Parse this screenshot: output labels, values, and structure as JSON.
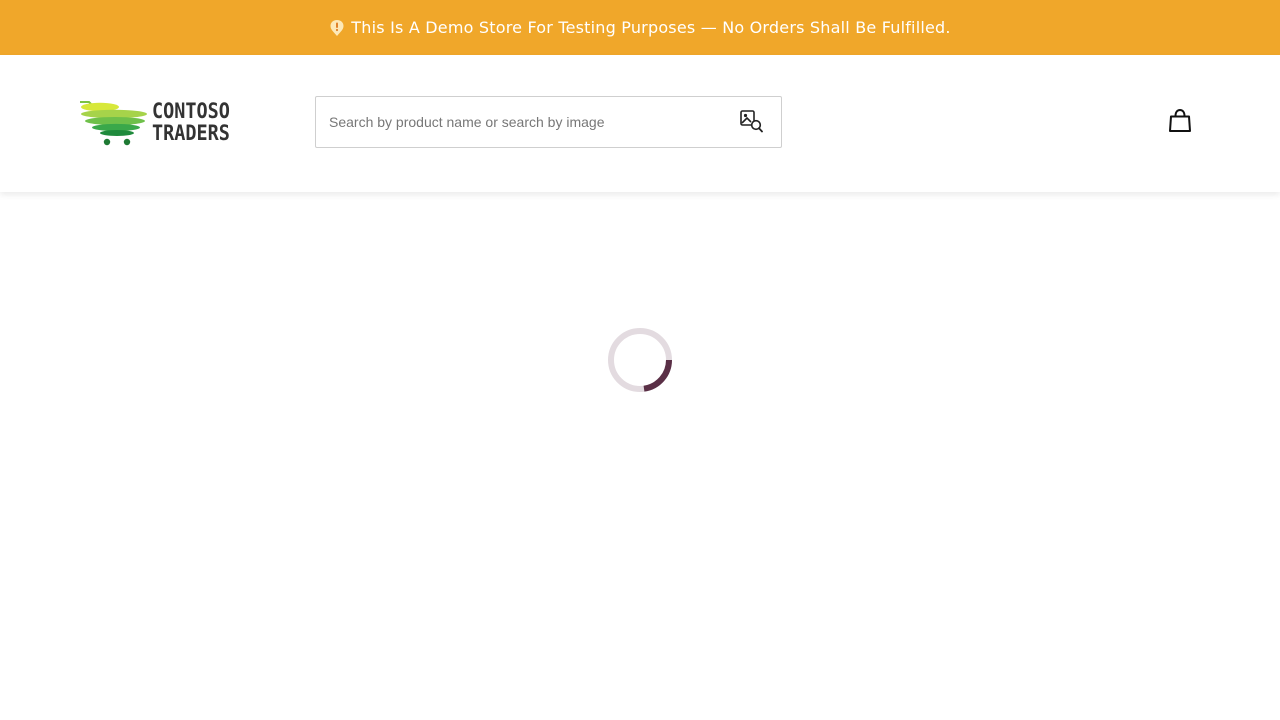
{
  "banner": {
    "text": "This Is A Demo Store For Testing Purposes — No Orders Shall Be Fulfilled.",
    "background": "#f0a72a",
    "icon": "alert-pin-icon"
  },
  "logo": {
    "line1": "CONTOSO",
    "line2": "TRADERS"
  },
  "search": {
    "placeholder": "Search by product name or search by image",
    "value": "",
    "image_search_icon": "image-search-icon"
  },
  "cart": {
    "icon": "shopping-bag-icon"
  },
  "loader": {
    "icon": "loading-spinner-icon",
    "track_color": "#e3dbe0",
    "arc_color": "#5a2f46"
  }
}
